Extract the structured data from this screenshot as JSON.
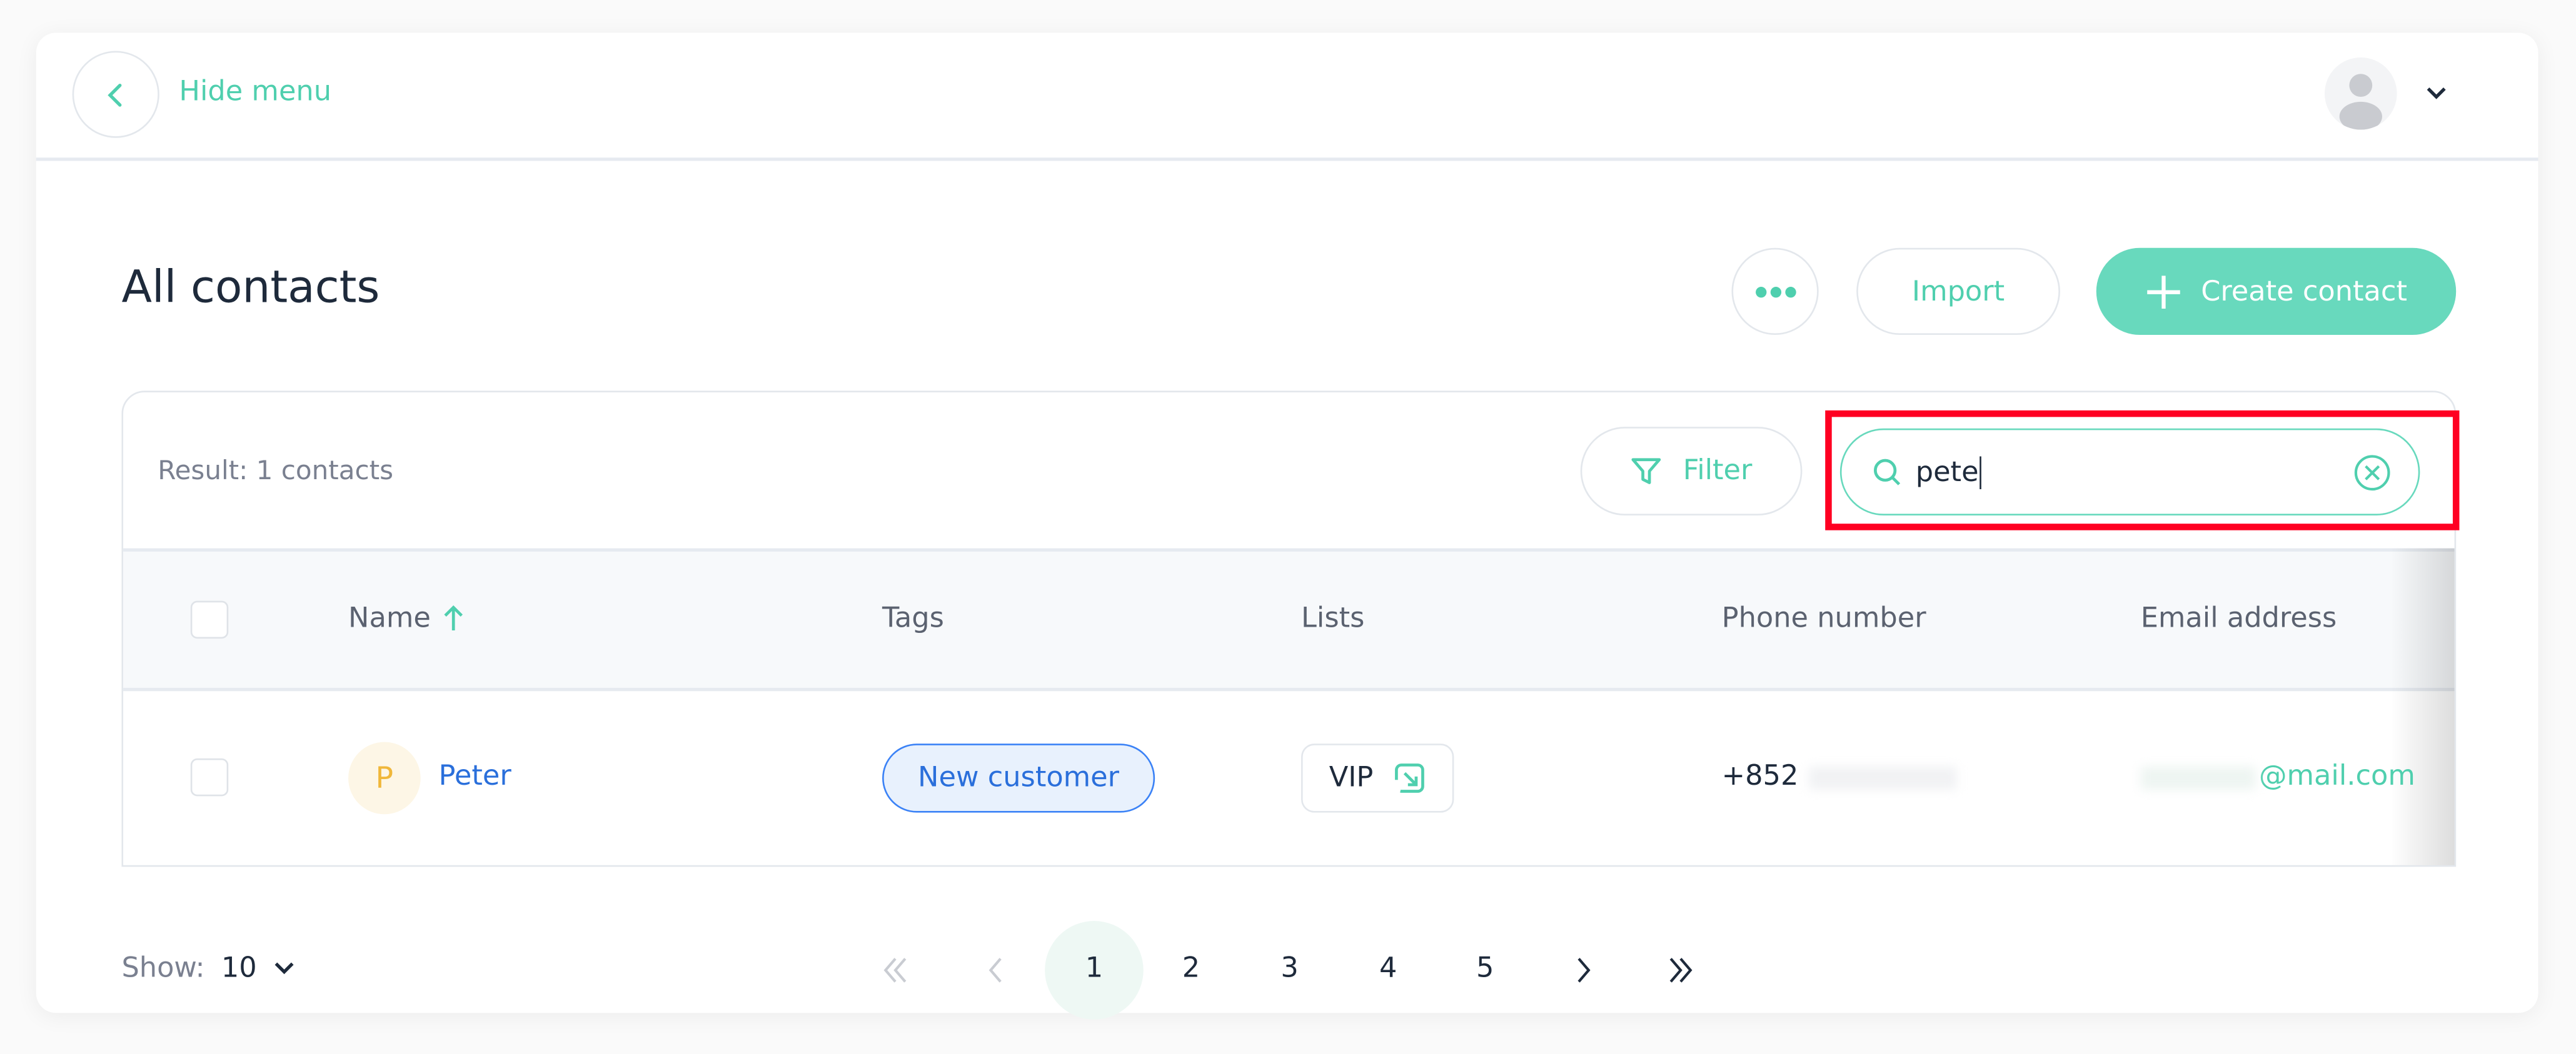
{
  "header": {
    "hide_menu_label": "Hide menu"
  },
  "page": {
    "title": "All contacts",
    "import_label": "Import",
    "create_label": "Create contact"
  },
  "toolbar": {
    "result_text": "Result: 1 contacts",
    "filter_label": "Filter",
    "search_value": "pete"
  },
  "table": {
    "columns": [
      "Name",
      "Tags",
      "Lists",
      "Phone number",
      "Email address"
    ],
    "rows": [
      {
        "initial": "P",
        "name": "Peter",
        "tag": "New customer",
        "list": "VIP",
        "phone": "+852",
        "email": "@mail.com"
      }
    ]
  },
  "footer": {
    "show_label": "Show:",
    "show_value": "10",
    "pages": [
      "1",
      "2",
      "3",
      "4",
      "5"
    ],
    "current_page": "1"
  },
  "colors": {
    "accent": "#68d9bd",
    "highlight": "#ff0022",
    "link": "#2a6fdb"
  }
}
